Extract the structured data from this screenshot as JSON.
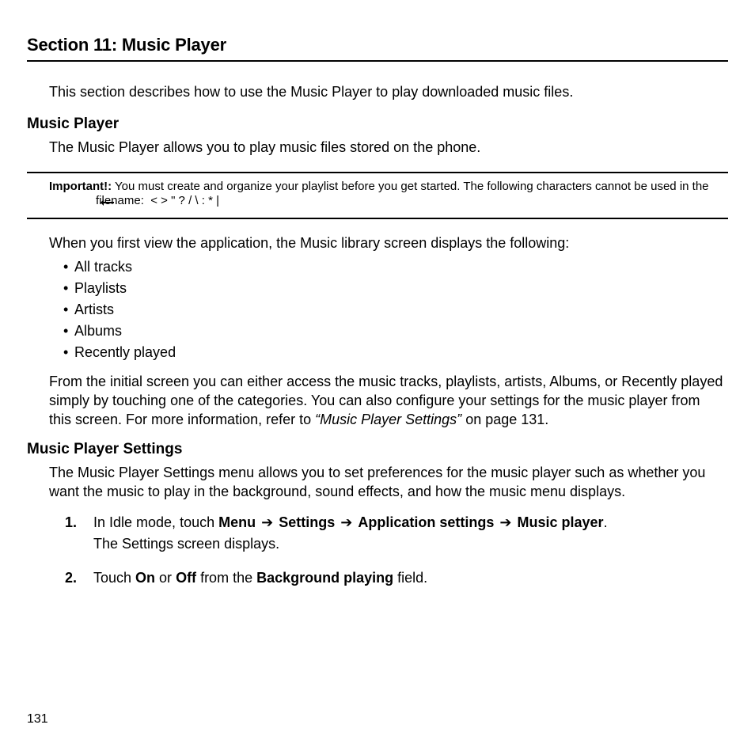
{
  "section": {
    "title": "Section 11: Music Player"
  },
  "intro": "This section describes how to use the Music Player to play downloaded music files.",
  "mp": {
    "heading": "Music Player",
    "body": "The Music Player allows you to play music files stored on the phone."
  },
  "important": {
    "label": "Important!:",
    "text_before": " You must create and organize your playlist before you get started. The following characters cannot be used in the filename:  ",
    "chars": " < >  \"  ?  /  \\  :  *  |"
  },
  "library": {
    "lead": "When you first view the application, the Music library screen displays the following:",
    "items": [
      "All tracks",
      "Playlists",
      "Artists",
      "Albums",
      "Recently played"
    ]
  },
  "nav_para": {
    "pre": "From the initial screen you can either access the music tracks, playlists, artists, Albums, or Recently played simply by touching one of the categories. You can also configure your settings for the music player from this screen. For more information, refer to ",
    "ref": "“Music Player Settings”",
    "post": "  on page 131."
  },
  "settings": {
    "heading": "Music Player Settings",
    "body": "The Music Player Settings menu allows you to set preferences for the music player such as whether you want the music to play in the background, sound effects, and how the music menu displays."
  },
  "steps": {
    "s1": {
      "pre": "In Idle mode, touch ",
      "menu": "Menu",
      "arrow": "➔",
      "settings": "Settings",
      "app": "Application settings",
      "mp": "Music player",
      "dot": ".",
      "after": "The Settings screen displays."
    },
    "s2": {
      "pre": "Touch ",
      "on": "On",
      "or": " or ",
      "off": "Off",
      "mid": " from the ",
      "bg": "Background playing",
      "post": " field."
    }
  },
  "page_number": "131"
}
